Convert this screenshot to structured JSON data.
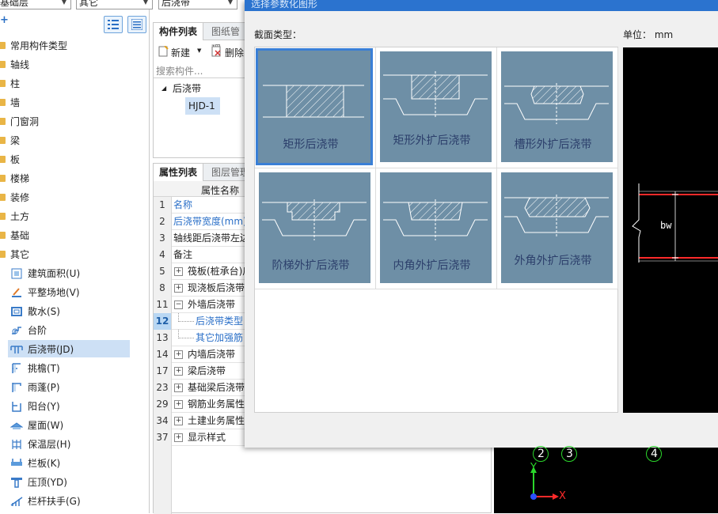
{
  "top_combos": [
    {
      "value": "基础层"
    },
    {
      "value": "其它"
    },
    {
      "value": "后浇带"
    }
  ],
  "tree": {
    "categories": [
      "常用构件类型",
      "轴线",
      "柱",
      "墙",
      "门窗洞",
      "梁",
      "板",
      "楼梯",
      "装修",
      "土方",
      "基础",
      "其它"
    ],
    "children": [
      {
        "label": "建筑面积(U)",
        "icon": "area-icon"
      },
      {
        "label": "平整场地(V)",
        "icon": "leveling-icon"
      },
      {
        "label": "散水(S)",
        "icon": "apron-icon"
      },
      {
        "label": "台阶",
        "icon": "steps-icon"
      },
      {
        "label": "后浇带(JD)",
        "icon": "post-cast-strip-icon",
        "selected": true
      },
      {
        "label": "挑檐(T)",
        "icon": "cornice-icon"
      },
      {
        "label": "雨蓬(P)",
        "icon": "canopy-icon"
      },
      {
        "label": "阳台(Y)",
        "icon": "balcony-icon"
      },
      {
        "label": "屋面(W)",
        "icon": "roof-icon"
      },
      {
        "label": "保温层(H)",
        "icon": "insulation-icon"
      },
      {
        "label": "栏板(K)",
        "icon": "parapet-icon"
      },
      {
        "label": "压顶(YD)",
        "icon": "coping-icon"
      },
      {
        "label": "栏杆扶手(G)",
        "icon": "railing-icon"
      }
    ]
  },
  "component_panel": {
    "tab_active": "构件列表",
    "tab_inactive": "图纸管理",
    "new_label": "新建",
    "delete_label": "删除",
    "search_placeholder": "搜索构件...",
    "group": "后浇带",
    "item": "HJD-1"
  },
  "property_panel": {
    "tab_active": "属性列表",
    "tab_inactive": "图层管理",
    "header": "属性名称",
    "rows": [
      {
        "num": "1",
        "name": "名称",
        "blue": true
      },
      {
        "num": "2",
        "name": "后浇带宽度(mm)",
        "blue": true
      },
      {
        "num": "3",
        "name": "轴线距后浇带左边"
      },
      {
        "num": "4",
        "name": "备注"
      },
      {
        "num": "5",
        "name": "筏板(桩承台)后",
        "expander": "+"
      },
      {
        "num": "8",
        "name": "现浇板后浇带",
        "expander": "+"
      },
      {
        "num": "11",
        "name": "外墙后浇带",
        "expander": "−"
      },
      {
        "num": "12",
        "name": "后浇带类型",
        "blue": true,
        "indent": true,
        "selected": true
      },
      {
        "num": "13",
        "name": "其它加强筋",
        "blue": true,
        "indent": true
      },
      {
        "num": "14",
        "name": "内墙后浇带",
        "expander": "+"
      },
      {
        "num": "17",
        "name": "梁后浇带",
        "expander": "+"
      },
      {
        "num": "23",
        "name": "基础梁后浇带",
        "expander": "+"
      },
      {
        "num": "29",
        "name": "钢筋业务属性",
        "expander": "+"
      },
      {
        "num": "34",
        "name": "土建业务属性",
        "expander": "+"
      },
      {
        "num": "37",
        "name": "显示样式",
        "expander": "+"
      }
    ]
  },
  "dialog": {
    "title": "选择参数化图形",
    "section_label": "截面类型：",
    "unit_label": "单位：  mm",
    "shapes": [
      {
        "caption": "矩形后浇带",
        "selected": true
      },
      {
        "caption": "矩形外扩后浇带"
      },
      {
        "caption": "槽形外扩后浇带"
      },
      {
        "caption": "阶梯外扩后浇带"
      },
      {
        "caption": "内角外扩后浇带"
      },
      {
        "caption": "外角外扩后浇带"
      }
    ],
    "preview_label": "bw"
  },
  "canvas": {
    "axis_labels": [
      "2",
      "3",
      "4"
    ],
    "x_label": "X",
    "y_label": "Y"
  },
  "colors": {
    "accent": "#2b73cf",
    "thumb_bg": "#6e8fa6",
    "selection": "#cde0f5",
    "folder": "#e9b546"
  }
}
